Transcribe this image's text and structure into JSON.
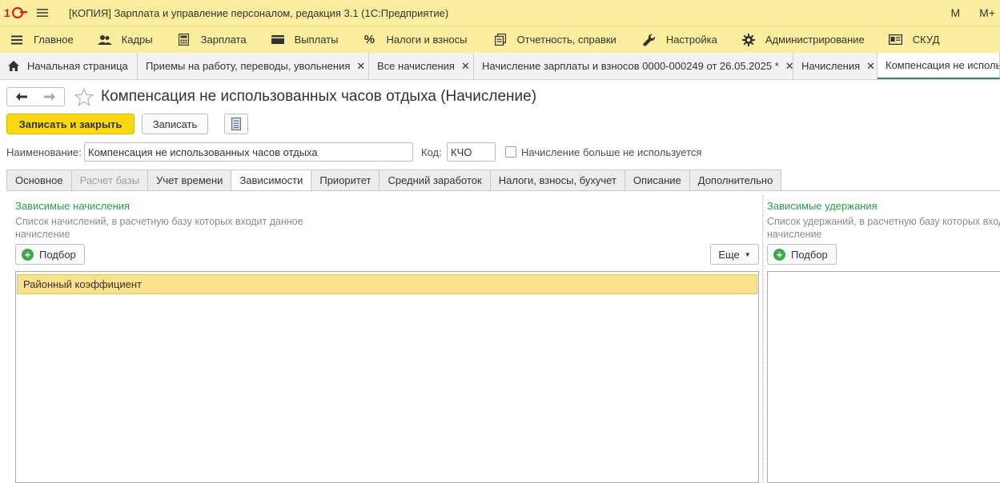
{
  "window": {
    "title": "[КОПИЯ] Зарплата и управление персоналом, редакция 3.1  (1С:Предприятие)",
    "right_buttons": [
      "M",
      "M+"
    ]
  },
  "sections": [
    {
      "label": "Главное",
      "icon": "menu-icon"
    },
    {
      "label": "Кадры",
      "icon": "people-icon"
    },
    {
      "label": "Зарплата",
      "icon": "calculator-icon"
    },
    {
      "label": "Выплаты",
      "icon": "wallet-icon"
    },
    {
      "label": "Налоги и взносы",
      "icon": "percent-icon"
    },
    {
      "label": "Отчетность, справки",
      "icon": "documents-icon"
    },
    {
      "label": "Настройка",
      "icon": "wrench-icon"
    },
    {
      "label": "Администрирование",
      "icon": "gear-icon"
    },
    {
      "label": "СКУД",
      "icon": "id-card-icon"
    }
  ],
  "open_tabs": [
    {
      "label": "Начальная страница"
    },
    {
      "label": "Приемы на работу, переводы, увольнения"
    },
    {
      "label": "Все начисления"
    },
    {
      "label": "Начисление зарплаты и взносов 0000-000249 от 26.05.2025 *"
    },
    {
      "label": "Начисления"
    },
    {
      "label": "Компенсация не использованных часов отдыха (Начисление)"
    }
  ],
  "form": {
    "title": "Компенсация не использованных часов отдыха (Начисление)",
    "save_close": "Записать и закрыть",
    "save": "Записать",
    "name_label": "Наименование:",
    "name_value": "Компенсация не использованных часов отдыха",
    "code_label": "Код:",
    "code_value": "КЧО",
    "unused_label": "Начисление больше не используется",
    "tabs": [
      {
        "label": "Основное"
      },
      {
        "label": "Расчет базы"
      },
      {
        "label": "Учет времени"
      },
      {
        "label": "Зависимости"
      },
      {
        "label": "Приоритет"
      },
      {
        "label": "Средний заработок"
      },
      {
        "label": "Налоги, взносы, бухучет"
      },
      {
        "label": "Описание"
      },
      {
        "label": "Дополнительно"
      }
    ]
  },
  "dependent_accruals": {
    "title": "Зависимые начисления",
    "desc_line1": "Список начислений, в расчетную базу которых входит данное",
    "desc_line2": "начисление",
    "pick": "Подбор",
    "more": "Еще",
    "rows": [
      "Районный коэффициент"
    ]
  },
  "dependent_deductions": {
    "title": "Зависимые удержания",
    "desc_line1": "Список удержаний, в расчетную базу которых входит данное",
    "desc_line2": "начисление",
    "pick": "Подбор"
  },
  "colors": {
    "header_bg": "#fbed9e",
    "primary_button": "#fcd80f",
    "selected_row": "#fae18b",
    "group_title": "#2e9a4c",
    "plus_icon": "#3fa84a"
  }
}
